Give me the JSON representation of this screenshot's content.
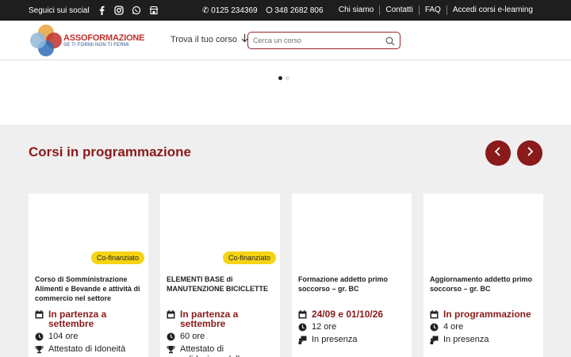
{
  "topbar": {
    "social_label": "Seguici sui social",
    "social_icons": [
      "facebook-icon",
      "instagram-icon",
      "whatsapp-icon",
      "store-icon"
    ],
    "phone1": "0125 234369",
    "phone2": "348 2682 806",
    "links": [
      "Chi siamo",
      "Contatti",
      "FAQ",
      "Accedi corsi e-learning"
    ]
  },
  "header": {
    "brand": "ASSOFORMAZIONE",
    "tagline": "SE TI FORMI NON TI FERMI",
    "finder_label": "Trova il tuo corso",
    "search_placeholder": "Cerca un corso"
  },
  "section": {
    "title": "Corsi in programmazione"
  },
  "colors": {
    "accent": "#8b1a1a",
    "badge": "#f6d313",
    "topbar": "#1e1e1e"
  },
  "cards": [
    {
      "badge": "Co-finanziato",
      "title": "Corso di Somministrazione Alimenti e Bevande e attività di commercio nel settore",
      "date": "In partenza a settembre",
      "hours": "104 ore",
      "extra": "Attestato di Idoneità"
    },
    {
      "badge": "Co-finanziato",
      "title": "ELEMENTI BASE di MANUTENZIONE BICICLETTE",
      "date": "In partenza a settembre",
      "hours": "60 ore",
      "extra": "Attestato di validazione delle"
    },
    {
      "badge": "",
      "title": "Formazione addetto primo soccorso – gr. BC",
      "date": "24/09 e 01/10/26",
      "hours": "12 ore",
      "extra": "In presenza"
    },
    {
      "badge": "",
      "title": "Aggiornamento addetto primo soccorso – gr. BC",
      "date": "In programmazione",
      "hours": "4 ore",
      "extra": "In presenza"
    }
  ]
}
